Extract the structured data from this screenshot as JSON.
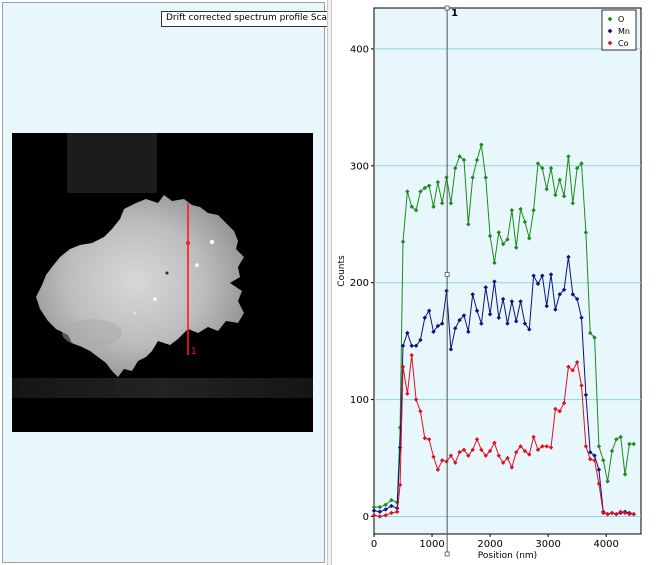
{
  "left_panel": {
    "status_label": "Drift corrected spectrum profile Scanning",
    "scan_line_marker": "1"
  },
  "chart": {
    "cursor_label": "1",
    "colors": {
      "O": "#1e8a1e",
      "Mn": "#101080",
      "Co": "#e01020",
      "grid": "#8fd3e6",
      "plot_bg": "#e8f7fc",
      "cursor": "#555555"
    }
  },
  "chart_data": {
    "type": "line",
    "xlabel": "Position (nm)",
    "ylabel": "Counts",
    "xlim": [
      0,
      4600
    ],
    "ylim": [
      -15,
      435
    ],
    "x_ticks": [
      0,
      1000,
      2000,
      3000,
      4000
    ],
    "y_ticks": [
      0,
      100,
      200,
      300,
      400
    ],
    "grid": true,
    "legend_position": "top-right",
    "cursor_x": 1260,
    "series": [
      {
        "name": "O",
        "color": "#1e8a1e",
        "x": [
          0,
          100,
          200,
          300,
          400,
          450,
          500,
          575,
          650,
          725,
          800,
          875,
          950,
          1025,
          1100,
          1175,
          1250,
          1325,
          1400,
          1475,
          1550,
          1625,
          1700,
          1775,
          1850,
          1925,
          2000,
          2075,
          2150,
          2225,
          2300,
          2375,
          2450,
          2525,
          2600,
          2675,
          2750,
          2825,
          2900,
          2975,
          3050,
          3125,
          3200,
          3275,
          3350,
          3425,
          3500,
          3575,
          3650,
          3725,
          3800,
          3875,
          3950,
          4025,
          4100,
          4175,
          4250,
          4325,
          4400,
          4475
        ],
        "values": [
          8,
          8,
          10,
          14,
          12,
          76,
          235,
          278,
          265,
          262,
          278,
          281,
          283,
          265,
          286,
          268,
          290,
          268,
          298,
          308,
          305,
          250,
          290,
          305,
          318,
          290,
          240,
          217,
          243,
          233,
          237,
          262,
          230,
          263,
          252,
          238,
          262,
          302,
          298,
          280,
          298,
          275,
          288,
          274,
          308,
          268,
          298,
          302,
          243,
          157,
          153,
          60,
          48,
          30,
          56,
          66,
          68,
          36,
          62,
          62
        ]
      },
      {
        "name": "Mn",
        "color": "#101080",
        "x": [
          0,
          100,
          200,
          300,
          400,
          450,
          500,
          575,
          650,
          725,
          800,
          875,
          950,
          1025,
          1100,
          1175,
          1250,
          1325,
          1400,
          1475,
          1550,
          1625,
          1700,
          1775,
          1850,
          1925,
          2000,
          2075,
          2150,
          2225,
          2300,
          2375,
          2450,
          2525,
          2600,
          2675,
          2750,
          2825,
          2900,
          2975,
          3050,
          3125,
          3200,
          3275,
          3350,
          3425,
          3500,
          3575,
          3650,
          3725,
          3800,
          3875,
          3950,
          4025,
          4100,
          4175,
          4250,
          4325,
          4400,
          4475
        ],
        "values": [
          5,
          4,
          6,
          9,
          7,
          59,
          146,
          157,
          146,
          146,
          151,
          170,
          176,
          158,
          163,
          165,
          193,
          143,
          161,
          168,
          172,
          158,
          190,
          176,
          165,
          196,
          173,
          201,
          170,
          186,
          165,
          184,
          167,
          184,
          165,
          160,
          206,
          199,
          206,
          180,
          207,
          177,
          190,
          194,
          222,
          190,
          186,
          170,
          104,
          55,
          52,
          40,
          4,
          2,
          3,
          2,
          3,
          4,
          3,
          2
        ]
      },
      {
        "name": "Co",
        "color": "#e01020",
        "x": [
          0,
          100,
          200,
          300,
          400,
          450,
          500,
          575,
          650,
          725,
          800,
          875,
          950,
          1025,
          1100,
          1175,
          1250,
          1325,
          1400,
          1475,
          1550,
          1625,
          1700,
          1775,
          1850,
          1925,
          2000,
          2075,
          2150,
          2225,
          2300,
          2375,
          2450,
          2525,
          2600,
          2675,
          2750,
          2825,
          2900,
          2975,
          3050,
          3125,
          3200,
          3275,
          3350,
          3425,
          3500,
          3575,
          3650,
          3725,
          3800,
          3875,
          3950,
          4025,
          4100,
          4175,
          4250,
          4325,
          4400,
          4475
        ],
        "values": [
          1,
          0,
          1,
          3,
          4,
          27,
          128,
          105,
          138,
          100,
          90,
          67,
          66,
          51,
          40,
          48,
          47,
          52,
          46,
          55,
          57,
          52,
          57,
          66,
          57,
          52,
          56,
          63,
          52,
          46,
          50,
          42,
          55,
          60,
          56,
          53,
          68,
          57,
          60,
          60,
          59,
          92,
          90,
          97,
          128,
          125,
          132,
          112,
          60,
          49,
          48,
          28,
          3,
          2,
          3,
          2,
          4,
          3,
          2,
          2
        ]
      }
    ]
  }
}
